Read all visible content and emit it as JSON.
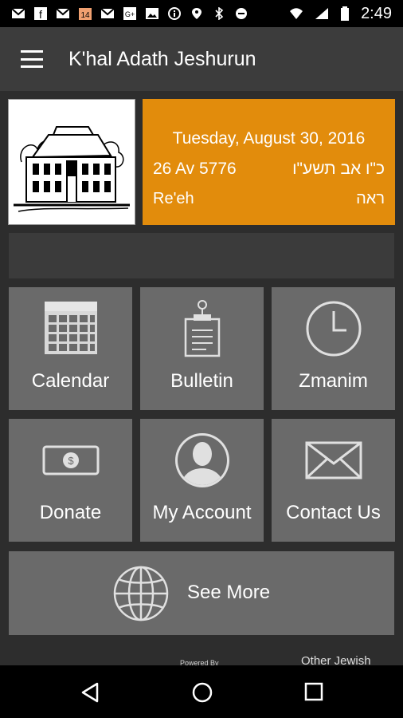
{
  "status_bar": {
    "time": "2:49",
    "icons": [
      "mail-icon",
      "facebook-icon",
      "email-icon",
      "calendar-icon",
      "gmail-icon",
      "google-plus-icon",
      "image-icon",
      "info-icon",
      "location-icon",
      "bluetooth-icon",
      "do-not-disturb-icon",
      "wifi-icon",
      "signal-icon",
      "battery-icon"
    ],
    "calendar_day": "14"
  },
  "app_bar": {
    "title": "K'hal Adath Jeshurun"
  },
  "date_card": {
    "gregorian": "Tuesday, August 30, 2016",
    "hebrew_date": "26 Av 5776",
    "hebrew_date_he": "כ\"ו אב תשע\"ו",
    "parsha": "Re'eh",
    "parsha_he": "ראה",
    "color": "#e28c0c"
  },
  "tiles": [
    {
      "label": "Calendar",
      "icon": "calendar-icon"
    },
    {
      "label": "Bulletin",
      "icon": "clipboard-icon"
    },
    {
      "label": "Zmanim",
      "icon": "clock-icon"
    },
    {
      "label": "Donate",
      "icon": "dollar-bill-icon"
    },
    {
      "label": "My Account",
      "icon": "user-icon"
    },
    {
      "label": "Contact Us",
      "icon": "envelope-icon"
    }
  ],
  "see_more": {
    "label": "See More",
    "icon": "globe-icon"
  },
  "footer": {
    "powered_by": "Powered By",
    "other": "Other Jewish"
  },
  "nav_bar": {
    "back": "back-icon",
    "home": "home-icon",
    "recents": "recents-icon"
  }
}
